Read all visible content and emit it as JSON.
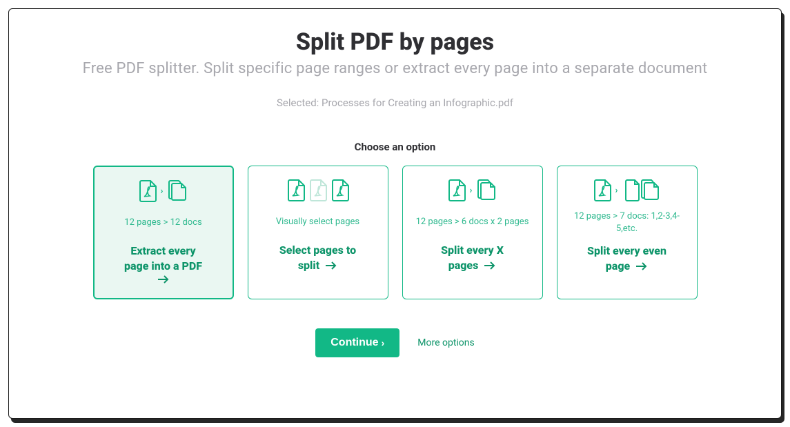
{
  "title": "Split PDF by pages",
  "subtitle": "Free PDF splitter. Split specific page ranges or extract every page into a separate document",
  "selected_prefix": "Selected: ",
  "selected_file": "Processes for Creating an Infographic.pdf",
  "choose_label": "Choose an option",
  "options": [
    {
      "desc": "12 pages > 12 docs",
      "action_line1": "Extract every",
      "action_line2": "page into a PDF"
    },
    {
      "desc": "Visually select pages",
      "action_line1": "Select pages to",
      "action_line2": "split"
    },
    {
      "desc": "12 pages > 6 docs x 2 pages",
      "action_line1": "Split every X",
      "action_line2": "pages"
    },
    {
      "desc": "12 pages > 7 docs: 1,2-3,4-5,etc.",
      "action_line1": "Split every even",
      "action_line2": "page"
    }
  ],
  "continue_label": "Continue",
  "more_label": "More options"
}
